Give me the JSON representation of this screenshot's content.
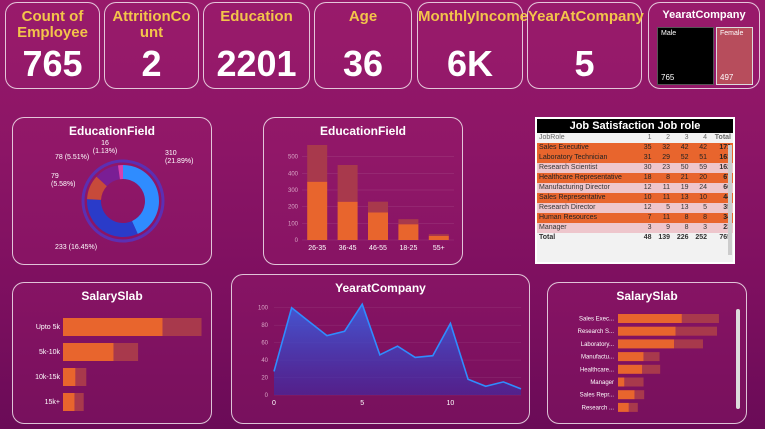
{
  "kpis": [
    {
      "title": "Count of Employee",
      "value": "765"
    },
    {
      "title": "AttritionCount",
      "value": "2"
    },
    {
      "title": "Education",
      "value": "2201"
    },
    {
      "title": "Age",
      "value": "36"
    },
    {
      "title": "MonthlyIncome",
      "value": "6K"
    },
    {
      "title": "YearAtCompany",
      "value": "5"
    }
  ],
  "gender_card": {
    "title": "YearatCompany",
    "male_label": "Male",
    "male_value": "765",
    "female_label": "Female",
    "female_value": "497"
  },
  "table": {
    "title": "Job Satisfaction Job role",
    "header": {
      "label": "JobRole",
      "c1": "1",
      "c2": "2",
      "c3": "3",
      "c4": "4",
      "total": "Total"
    },
    "rows": [
      {
        "label": "Sales Executive",
        "c1": "35",
        "c2": "32",
        "c3": "42",
        "c4": "42",
        "total": "171"
      },
      {
        "label": "Laboratory Technician",
        "c1": "31",
        "c2": "29",
        "c3": "52",
        "c4": "51",
        "total": "163"
      },
      {
        "label": "Research Scientist",
        "c1": "30",
        "c2": "23",
        "c3": "50",
        "c4": "59",
        "total": "162"
      },
      {
        "label": "Healthcare Representative",
        "c1": "18",
        "c2": "8",
        "c3": "21",
        "c4": "20",
        "total": "67"
      },
      {
        "label": "Manufacturing Director",
        "c1": "12",
        "c2": "11",
        "c3": "19",
        "c4": "24",
        "total": "66"
      },
      {
        "label": "Sales Representative",
        "c1": "10",
        "c2": "11",
        "c3": "13",
        "c4": "10",
        "total": "44"
      },
      {
        "label": "Research Director",
        "c1": "12",
        "c2": "5",
        "c3": "13",
        "c4": "5",
        "total": "35"
      },
      {
        "label": "Human Resources",
        "c1": "7",
        "c2": "11",
        "c3": "8",
        "c4": "8",
        "total": "34"
      },
      {
        "label": "Manager",
        "c1": "3",
        "c2": "9",
        "c3": "8",
        "c4": "3",
        "total": "23"
      }
    ],
    "total": {
      "label": "Total",
      "c1": "48",
      "c2": "139",
      "c3": "226",
      "c4": "252",
      "total": "765"
    }
  },
  "colors": {
    "orange": "#e8652d",
    "dark_red": "#a8394c",
    "blue_bright": "#2f8cff",
    "blue_dark": "#1f2fb0",
    "kpi_title": "#f3c44a"
  },
  "chart_data": [
    {
      "type": "pie",
      "title": "EducationField",
      "slices": [
        {
          "value": 310,
          "label": "310",
          "label2": "(21.89%)",
          "color": "#2f8cff"
        },
        {
          "value": 233,
          "label": "233 (16.45%)",
          "color": "#2a3bc9"
        },
        {
          "value": 79,
          "label": "79",
          "label2": "(5.58%)",
          "color": "#c74a3a"
        },
        {
          "value": 78,
          "label": "78 (5.51%)",
          "color": "#7a1e95"
        },
        {
          "value": 16,
          "label": "16",
          "label2": "(1.13%)",
          "color": "#d640b0"
        }
      ]
    },
    {
      "type": "bar",
      "title": "EducationField",
      "categories": [
        "26-35",
        "36-45",
        "46-55",
        "18-25",
        "55+"
      ],
      "series": [
        {
          "values": [
            350,
            230,
            165,
            95,
            25
          ]
        },
        {
          "values": [
            220,
            220,
            65,
            30,
            10
          ]
        }
      ],
      "yticks": [
        "0",
        "100",
        "200",
        "300",
        "400",
        "500"
      ],
      "ylim": [
        0,
        600
      ]
    },
    {
      "type": "bar",
      "title": "SalarySlab",
      "orientation": "horizontal",
      "categories": [
        "Upto 5k",
        "5k-10k",
        "10k-15k",
        "15k+"
      ],
      "series": [
        {
          "values": [
            385,
            195,
            48,
            45
          ]
        },
        {
          "values": [
            150,
            95,
            42,
            35
          ]
        }
      ],
      "xlim": [
        0,
        560
      ]
    },
    {
      "type": "area",
      "title": "YearatCompany",
      "x": [
        0,
        1,
        2,
        3,
        4,
        5,
        6,
        7,
        8,
        9,
        10,
        11,
        12,
        13,
        14
      ],
      "y": [
        27,
        100,
        84,
        68,
        73,
        104,
        46,
        56,
        43,
        45,
        82,
        18,
        10,
        15,
        7
      ],
      "xticks": [
        "0",
        "5",
        "10"
      ],
      "yticks": [
        "0",
        "20",
        "40",
        "60",
        "80",
        "100"
      ],
      "xlim": [
        0,
        14
      ],
      "ylim": [
        0,
        110
      ]
    },
    {
      "type": "bar",
      "title": "SalarySlab",
      "orientation": "horizontal",
      "categories": [
        "Sales Exec...",
        "Research S...",
        "Laboratory...",
        "Manufactu...",
        "Healthcare...",
        "Manager",
        "Sales Repr...",
        "Research ..."
      ],
      "series": [
        {
          "values": [
            100,
            90,
            88,
            40,
            38,
            10,
            26,
            17
          ]
        },
        {
          "values": [
            58,
            65,
            45,
            25,
            28,
            30,
            15,
            14
          ]
        }
      ],
      "xlim": [
        0,
        180
      ]
    }
  ]
}
